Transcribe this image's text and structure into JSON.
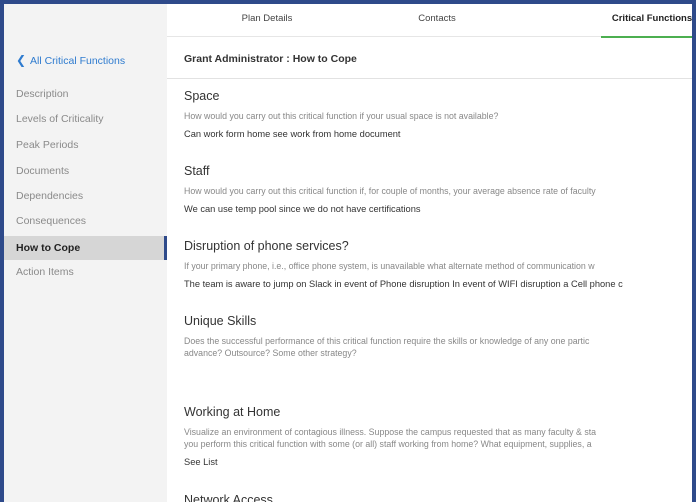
{
  "tabs": [
    {
      "label": "Plan Details",
      "active": false
    },
    {
      "label": "Contacts",
      "active": false
    },
    {
      "label": "Critical Functions",
      "active": true
    }
  ],
  "sidebar": {
    "back_label": "All Critical Functions",
    "items": [
      {
        "label": "Description",
        "active": false
      },
      {
        "label": "Levels of Criticality",
        "active": false
      },
      {
        "label": "Peak Periods",
        "active": false
      },
      {
        "label": "Documents",
        "active": false
      },
      {
        "label": "Dependencies",
        "active": false
      },
      {
        "label": "Consequences",
        "active": false
      },
      {
        "label": "How to Cope",
        "active": true
      },
      {
        "label": "Action Items",
        "active": false
      }
    ]
  },
  "main": {
    "title": "Grant Administrator : How to Cope",
    "sections": [
      {
        "heading": "Space",
        "question": "How would you carry out this critical function if your usual space is not available?",
        "answer": "Can work form home see work from home document"
      },
      {
        "heading": "Staff",
        "question": "How would you carry out this critical function if, for couple of months, your average absence rate of faculty",
        "answer": "We can use temp pool since we do not have certifications"
      },
      {
        "heading": "Disruption of phone services?",
        "question": "If your primary phone, i.e., office phone system, is unavailable what alternate method of communication w",
        "answer": "The team is aware to jump on Slack in event of Phone disruption In event of WIFI disruption a Cell phone c"
      },
      {
        "heading": "Unique Skills",
        "question_lines": [
          "Does the successful performance of this critical function require the skills or knowledge of any one partic",
          "advance? Outsource? Some other strategy?"
        ],
        "answer": ""
      },
      {
        "heading": "Working at Home",
        "question_lines": [
          "Visualize an environment of contagious illness. Suppose the campus requested that as many faculty & sta",
          "you perform this critical function with some (or all) staff working from home? What equipment, supplies, a"
        ],
        "answer": "See List"
      },
      {
        "heading": "Network Access",
        "question": "",
        "answer": ""
      }
    ]
  },
  "colors": {
    "outer_border": "#2e4a8a",
    "link": "#2e7bcf",
    "active_tab_underline": "#4caf50",
    "sidebar_bg": "#f3f3f3",
    "sidebar_active_bg": "#d6d6d6"
  },
  "icons": {
    "back": "chevron-left-icon"
  }
}
